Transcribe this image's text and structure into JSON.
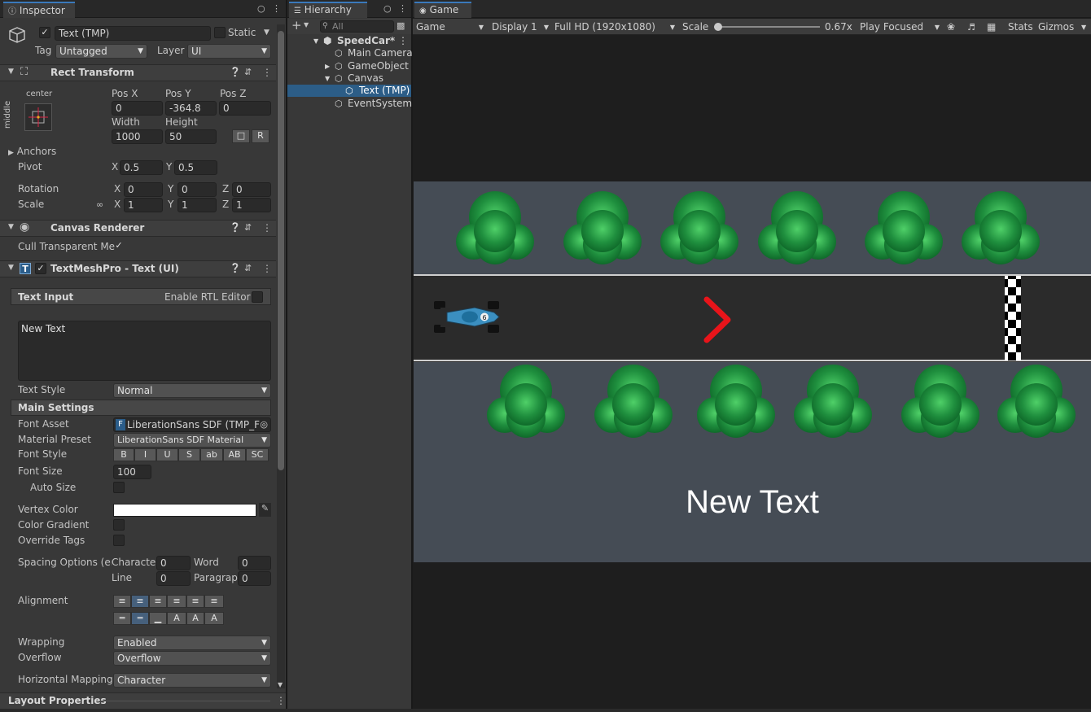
{
  "inspector": {
    "tab": "Inspector",
    "object_name": "Text (TMP)",
    "static_label": "Static",
    "tag_label": "Tag",
    "tag_value": "Untagged",
    "layer_label": "Layer",
    "layer_value": "UI",
    "rect_transform": {
      "title": "Rect Transform",
      "anchor_h": "center",
      "anchor_v": "middle",
      "pos_x_label": "Pos X",
      "pos_y_label": "Pos Y",
      "pos_z_label": "Pos Z",
      "pos_x": "0",
      "pos_y": "-364.8",
      "pos_z": "0",
      "width_label": "Width",
      "height_label": "Height",
      "width": "1000",
      "height": "50",
      "r_label": "R",
      "anchors_label": "Anchors",
      "pivot_label": "Pivot",
      "pivot_x": "0.5",
      "pivot_y": "0.5",
      "rotation_label": "Rotation",
      "rot_x": "0",
      "rot_y": "0",
      "rot_z": "0",
      "scale_label": "Scale",
      "scale_x": "1",
      "scale_y": "1",
      "scale_z": "1",
      "x": "X",
      "y": "Y",
      "z": "Z"
    },
    "canvas_renderer": {
      "title": "Canvas Renderer",
      "cull_label": "Cull Transparent Me",
      "check": "✓"
    },
    "tmp": {
      "title": "TextMeshPro - Text (UI)",
      "icon_letter": "T",
      "text_input_label": "Text Input",
      "rtl_label": "Enable RTL Editor",
      "text_value": "New Text",
      "text_style_label": "Text Style",
      "text_style_value": "Normal",
      "main_settings_label": "Main Settings",
      "font_asset_label": "Font Asset",
      "font_asset_icon": "F",
      "font_asset_value": "LiberationSans SDF (TMP_Fo",
      "material_label": "Material Preset",
      "material_value": "LiberationSans SDF Material",
      "font_style_label": "Font Style",
      "font_styles": [
        "B",
        "I",
        "U",
        "S",
        "ab",
        "AB",
        "SC"
      ],
      "font_size_label": "Font Size",
      "font_size_value": "100",
      "auto_size_label": "Auto Size",
      "vertex_color_label": "Vertex Color",
      "color_gradient_label": "Color Gradient",
      "override_tags_label": "Override Tags",
      "spacing_label": "Spacing Options (em",
      "character_label": "Characte",
      "character_value": "0",
      "word_label": "Word",
      "word_value": "0",
      "line_label": "Line",
      "line_value": "0",
      "paragraph_label": "Paragrapl",
      "paragraph_value": "0",
      "alignment_label": "Alignment",
      "wrapping_label": "Wrapping",
      "wrapping_value": "Enabled",
      "overflow_label": "Overflow",
      "overflow_value": "Overflow",
      "hmapping_label": "Horizontal Mapping",
      "hmapping_value": "Character"
    },
    "layout_properties": "Layout Properties"
  },
  "hierarchy": {
    "tab": "Hierarchy",
    "search_placeholder": "All",
    "add_label": "+",
    "scene": "SpeedCar*",
    "items": [
      "Main Camera",
      "GameObject",
      "Canvas",
      "Text (TMP)",
      "EventSystem"
    ]
  },
  "game": {
    "tab": "Game",
    "view_dropdown": "Game",
    "display": "Display 1",
    "resolution": "Full HD (1920x1080)",
    "scale_label": "Scale",
    "scale_value": "0.67x",
    "play_focused": "Play Focused",
    "stats": "Stats",
    "gizmos": "Gizmos",
    "scene_text": "New Text",
    "arrow_color": "#e8141a",
    "grass_color": "#454c55",
    "road_color": "#2b2b2b",
    "tree_color": "#1f8f3e"
  }
}
